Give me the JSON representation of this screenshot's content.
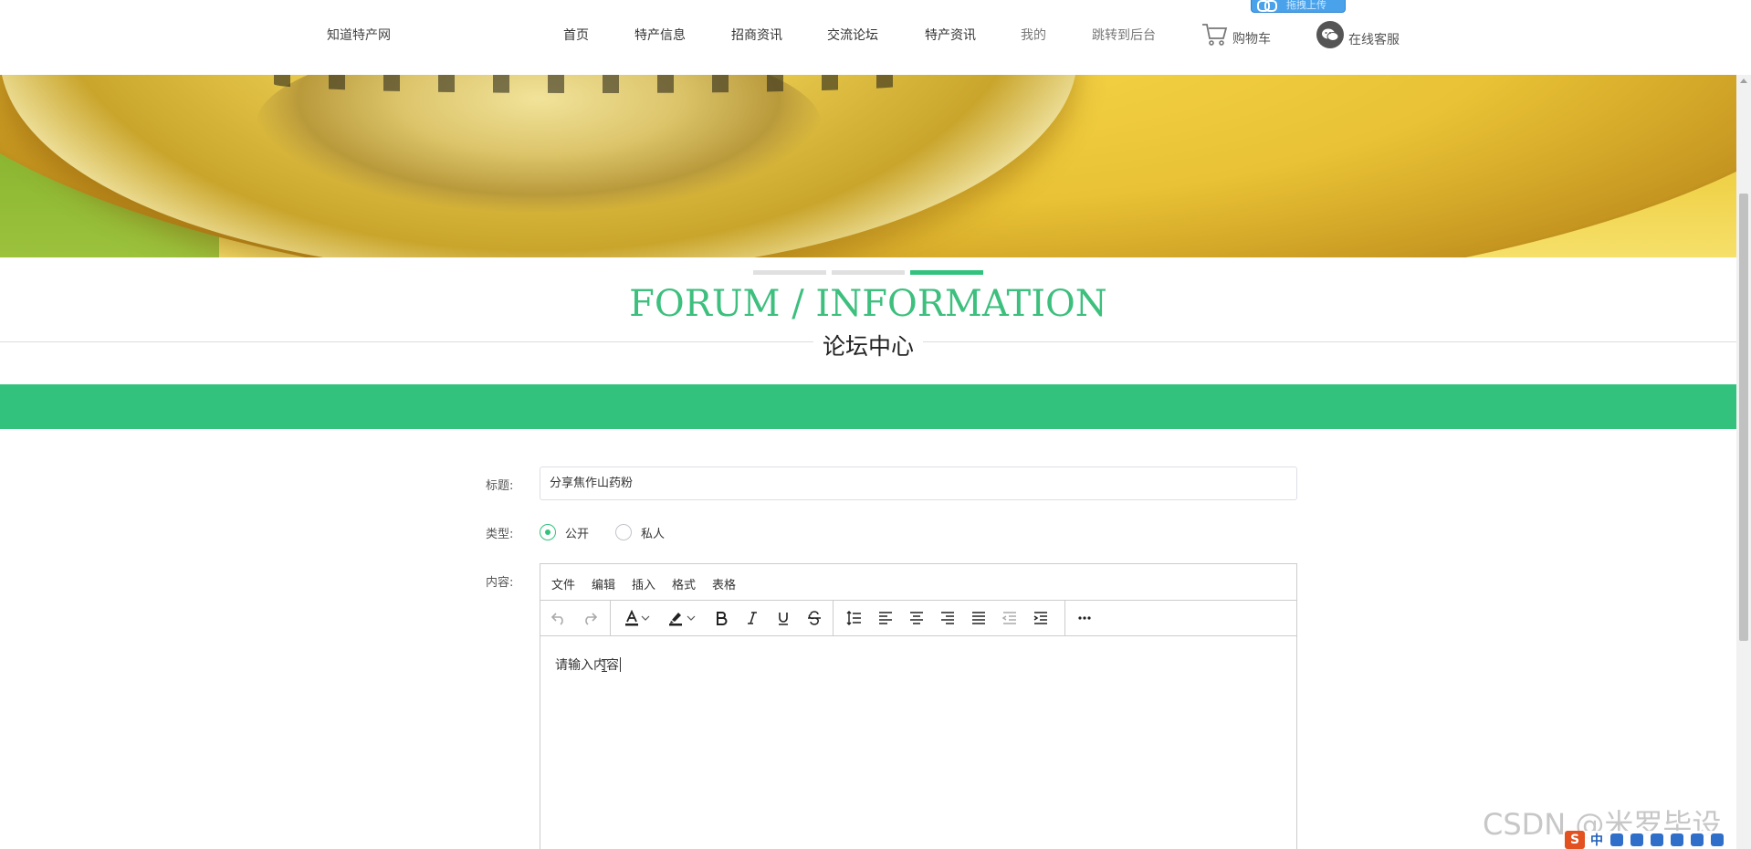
{
  "header": {
    "logo": "知道特产网",
    "nav": [
      "首页",
      "特产信息",
      "招商资讯",
      "交流论坛",
      "特产资讯",
      "我的",
      "跳转到后台"
    ],
    "cart_label": "购物车",
    "service_label": "在线客服",
    "upload_badge": "拖拽上传"
  },
  "section": {
    "en_title": "FORUM / INFORMATION",
    "cn_title": "论坛中心"
  },
  "form": {
    "title_label": "标题:",
    "title_value": "分享焦作山药粉",
    "type_label": "类型:",
    "type_options": [
      "公开",
      "私人"
    ],
    "type_selected": "公开",
    "content_label": "内容:",
    "editor_menu": [
      "文件",
      "编辑",
      "插入",
      "格式",
      "表格"
    ],
    "editor_text": "请输入内容"
  },
  "watermark": "CSDN @米罗毕设",
  "ime": {
    "mode": "中"
  },
  "colors": {
    "accent": "#33c27e",
    "title_green": "#3dbf7e"
  }
}
